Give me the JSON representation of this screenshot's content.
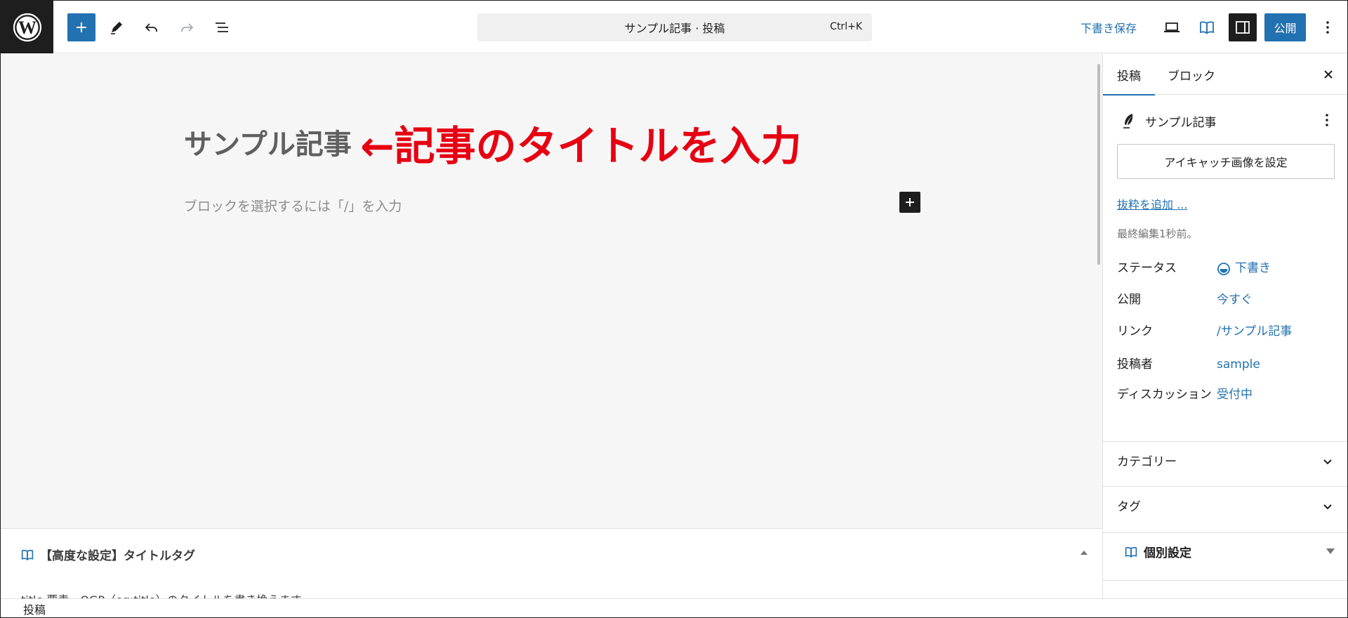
{
  "header": {
    "logo": "wordpress-icon",
    "command_bar_title": "サンプル記事 · 投稿",
    "command_bar_shortcut": "Ctrl+K",
    "save_draft": "下書き保存",
    "publish": "公開"
  },
  "editor": {
    "post_title": "サンプル記事",
    "annotation": "←記事のタイトルを入力",
    "annotation_color": "#e60012",
    "block_placeholder": "ブロックを選択するには「/」を入力"
  },
  "metabox": {
    "title": "【高度な設定】タイトルタグ",
    "description": "title 要素・OGP（og:title）のタイトルを書き換えます"
  },
  "footer": {
    "breadcrumb": "投稿"
  },
  "sidebar": {
    "tabs": [
      {
        "label": "投稿",
        "active": true
      },
      {
        "label": "ブロック",
        "active": false
      }
    ],
    "post_summary_title": "サンプル記事",
    "featured_image_button": "アイキャッチ画像を設定",
    "excerpt_link": "抜粋を追加 ...",
    "last_edited": "最終編集1秒前。",
    "meta": [
      {
        "label": "ステータス",
        "value": "下書き"
      },
      {
        "label": "公開",
        "value": "今すぐ"
      },
      {
        "label": "リンク",
        "value": "/サンプル記事"
      },
      {
        "label": "投稿者",
        "value": "sample"
      },
      {
        "label": "ディスカッション",
        "value": "受付中"
      }
    ],
    "panels": {
      "categories": "カテゴリー",
      "tags": "タグ",
      "custom_settings": "個別設定"
    }
  },
  "colors": {
    "accent": "#2271b1",
    "dark": "#1e1e1e"
  }
}
